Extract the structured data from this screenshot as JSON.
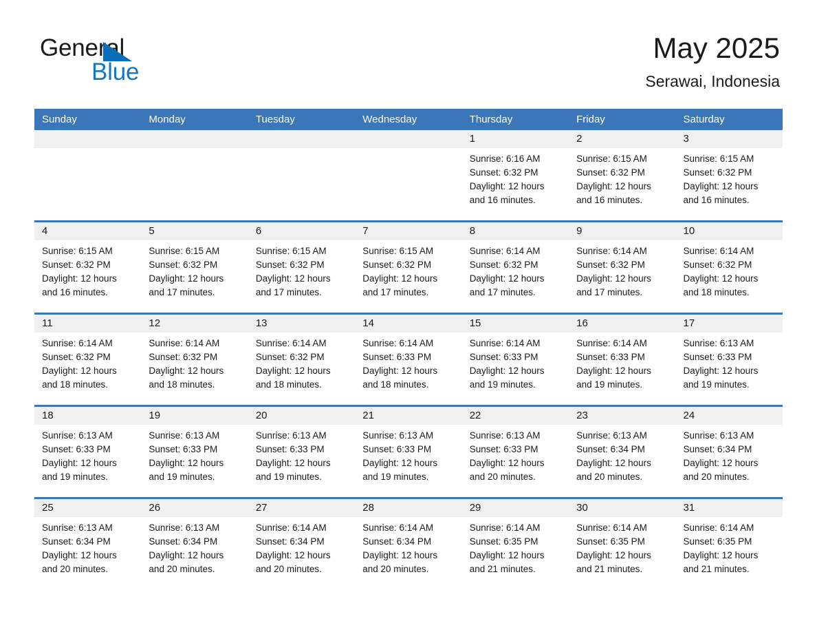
{
  "brand": {
    "name_part1": "General",
    "name_part2": "Blue",
    "accent_color": "#1477c4",
    "triangle_color": "#0b6cb7"
  },
  "header": {
    "title": "May 2025",
    "location": "Serawai, Indonesia"
  },
  "calendar": {
    "header_bg": "#3b77b8",
    "day_band_bg": "#f0f0f0",
    "weekdays": [
      "Sunday",
      "Monday",
      "Tuesday",
      "Wednesday",
      "Thursday",
      "Friday",
      "Saturday"
    ],
    "weeks": [
      [
        {
          "day": "",
          "empty": true,
          "lines": []
        },
        {
          "day": "",
          "empty": true,
          "lines": []
        },
        {
          "day": "",
          "empty": true,
          "lines": []
        },
        {
          "day": "",
          "empty": true,
          "lines": []
        },
        {
          "day": "1",
          "empty": false,
          "lines": [
            "Sunrise: 6:16 AM",
            "Sunset: 6:32 PM",
            "Daylight: 12 hours and 16 minutes."
          ]
        },
        {
          "day": "2",
          "empty": false,
          "lines": [
            "Sunrise: 6:15 AM",
            "Sunset: 6:32 PM",
            "Daylight: 12 hours and 16 minutes."
          ]
        },
        {
          "day": "3",
          "empty": false,
          "lines": [
            "Sunrise: 6:15 AM",
            "Sunset: 6:32 PM",
            "Daylight: 12 hours and 16 minutes."
          ]
        }
      ],
      [
        {
          "day": "4",
          "empty": false,
          "lines": [
            "Sunrise: 6:15 AM",
            "Sunset: 6:32 PM",
            "Daylight: 12 hours and 16 minutes."
          ]
        },
        {
          "day": "5",
          "empty": false,
          "lines": [
            "Sunrise: 6:15 AM",
            "Sunset: 6:32 PM",
            "Daylight: 12 hours and 17 minutes."
          ]
        },
        {
          "day": "6",
          "empty": false,
          "lines": [
            "Sunrise: 6:15 AM",
            "Sunset: 6:32 PM",
            "Daylight: 12 hours and 17 minutes."
          ]
        },
        {
          "day": "7",
          "empty": false,
          "lines": [
            "Sunrise: 6:15 AM",
            "Sunset: 6:32 PM",
            "Daylight: 12 hours and 17 minutes."
          ]
        },
        {
          "day": "8",
          "empty": false,
          "lines": [
            "Sunrise: 6:14 AM",
            "Sunset: 6:32 PM",
            "Daylight: 12 hours and 17 minutes."
          ]
        },
        {
          "day": "9",
          "empty": false,
          "lines": [
            "Sunrise: 6:14 AM",
            "Sunset: 6:32 PM",
            "Daylight: 12 hours and 17 minutes."
          ]
        },
        {
          "day": "10",
          "empty": false,
          "lines": [
            "Sunrise: 6:14 AM",
            "Sunset: 6:32 PM",
            "Daylight: 12 hours and 18 minutes."
          ]
        }
      ],
      [
        {
          "day": "11",
          "empty": false,
          "lines": [
            "Sunrise: 6:14 AM",
            "Sunset: 6:32 PM",
            "Daylight: 12 hours and 18 minutes."
          ]
        },
        {
          "day": "12",
          "empty": false,
          "lines": [
            "Sunrise: 6:14 AM",
            "Sunset: 6:32 PM",
            "Daylight: 12 hours and 18 minutes."
          ]
        },
        {
          "day": "13",
          "empty": false,
          "lines": [
            "Sunrise: 6:14 AM",
            "Sunset: 6:32 PM",
            "Daylight: 12 hours and 18 minutes."
          ]
        },
        {
          "day": "14",
          "empty": false,
          "lines": [
            "Sunrise: 6:14 AM",
            "Sunset: 6:33 PM",
            "Daylight: 12 hours and 18 minutes."
          ]
        },
        {
          "day": "15",
          "empty": false,
          "lines": [
            "Sunrise: 6:14 AM",
            "Sunset: 6:33 PM",
            "Daylight: 12 hours and 19 minutes."
          ]
        },
        {
          "day": "16",
          "empty": false,
          "lines": [
            "Sunrise: 6:14 AM",
            "Sunset: 6:33 PM",
            "Daylight: 12 hours and 19 minutes."
          ]
        },
        {
          "day": "17",
          "empty": false,
          "lines": [
            "Sunrise: 6:13 AM",
            "Sunset: 6:33 PM",
            "Daylight: 12 hours and 19 minutes."
          ]
        }
      ],
      [
        {
          "day": "18",
          "empty": false,
          "lines": [
            "Sunrise: 6:13 AM",
            "Sunset: 6:33 PM",
            "Daylight: 12 hours and 19 minutes."
          ]
        },
        {
          "day": "19",
          "empty": false,
          "lines": [
            "Sunrise: 6:13 AM",
            "Sunset: 6:33 PM",
            "Daylight: 12 hours and 19 minutes."
          ]
        },
        {
          "day": "20",
          "empty": false,
          "lines": [
            "Sunrise: 6:13 AM",
            "Sunset: 6:33 PM",
            "Daylight: 12 hours and 19 minutes."
          ]
        },
        {
          "day": "21",
          "empty": false,
          "lines": [
            "Sunrise: 6:13 AM",
            "Sunset: 6:33 PM",
            "Daylight: 12 hours and 19 minutes."
          ]
        },
        {
          "day": "22",
          "empty": false,
          "lines": [
            "Sunrise: 6:13 AM",
            "Sunset: 6:33 PM",
            "Daylight: 12 hours and 20 minutes."
          ]
        },
        {
          "day": "23",
          "empty": false,
          "lines": [
            "Sunrise: 6:13 AM",
            "Sunset: 6:34 PM",
            "Daylight: 12 hours and 20 minutes."
          ]
        },
        {
          "day": "24",
          "empty": false,
          "lines": [
            "Sunrise: 6:13 AM",
            "Sunset: 6:34 PM",
            "Daylight: 12 hours and 20 minutes."
          ]
        }
      ],
      [
        {
          "day": "25",
          "empty": false,
          "lines": [
            "Sunrise: 6:13 AM",
            "Sunset: 6:34 PM",
            "Daylight: 12 hours and 20 minutes."
          ]
        },
        {
          "day": "26",
          "empty": false,
          "lines": [
            "Sunrise: 6:13 AM",
            "Sunset: 6:34 PM",
            "Daylight: 12 hours and 20 minutes."
          ]
        },
        {
          "day": "27",
          "empty": false,
          "lines": [
            "Sunrise: 6:14 AM",
            "Sunset: 6:34 PM",
            "Daylight: 12 hours and 20 minutes."
          ]
        },
        {
          "day": "28",
          "empty": false,
          "lines": [
            "Sunrise: 6:14 AM",
            "Sunset: 6:34 PM",
            "Daylight: 12 hours and 20 minutes."
          ]
        },
        {
          "day": "29",
          "empty": false,
          "lines": [
            "Sunrise: 6:14 AM",
            "Sunset: 6:35 PM",
            "Daylight: 12 hours and 21 minutes."
          ]
        },
        {
          "day": "30",
          "empty": false,
          "lines": [
            "Sunrise: 6:14 AM",
            "Sunset: 6:35 PM",
            "Daylight: 12 hours and 21 minutes."
          ]
        },
        {
          "day": "31",
          "empty": false,
          "lines": [
            "Sunrise: 6:14 AM",
            "Sunset: 6:35 PM",
            "Daylight: 12 hours and 21 minutes."
          ]
        }
      ]
    ]
  }
}
